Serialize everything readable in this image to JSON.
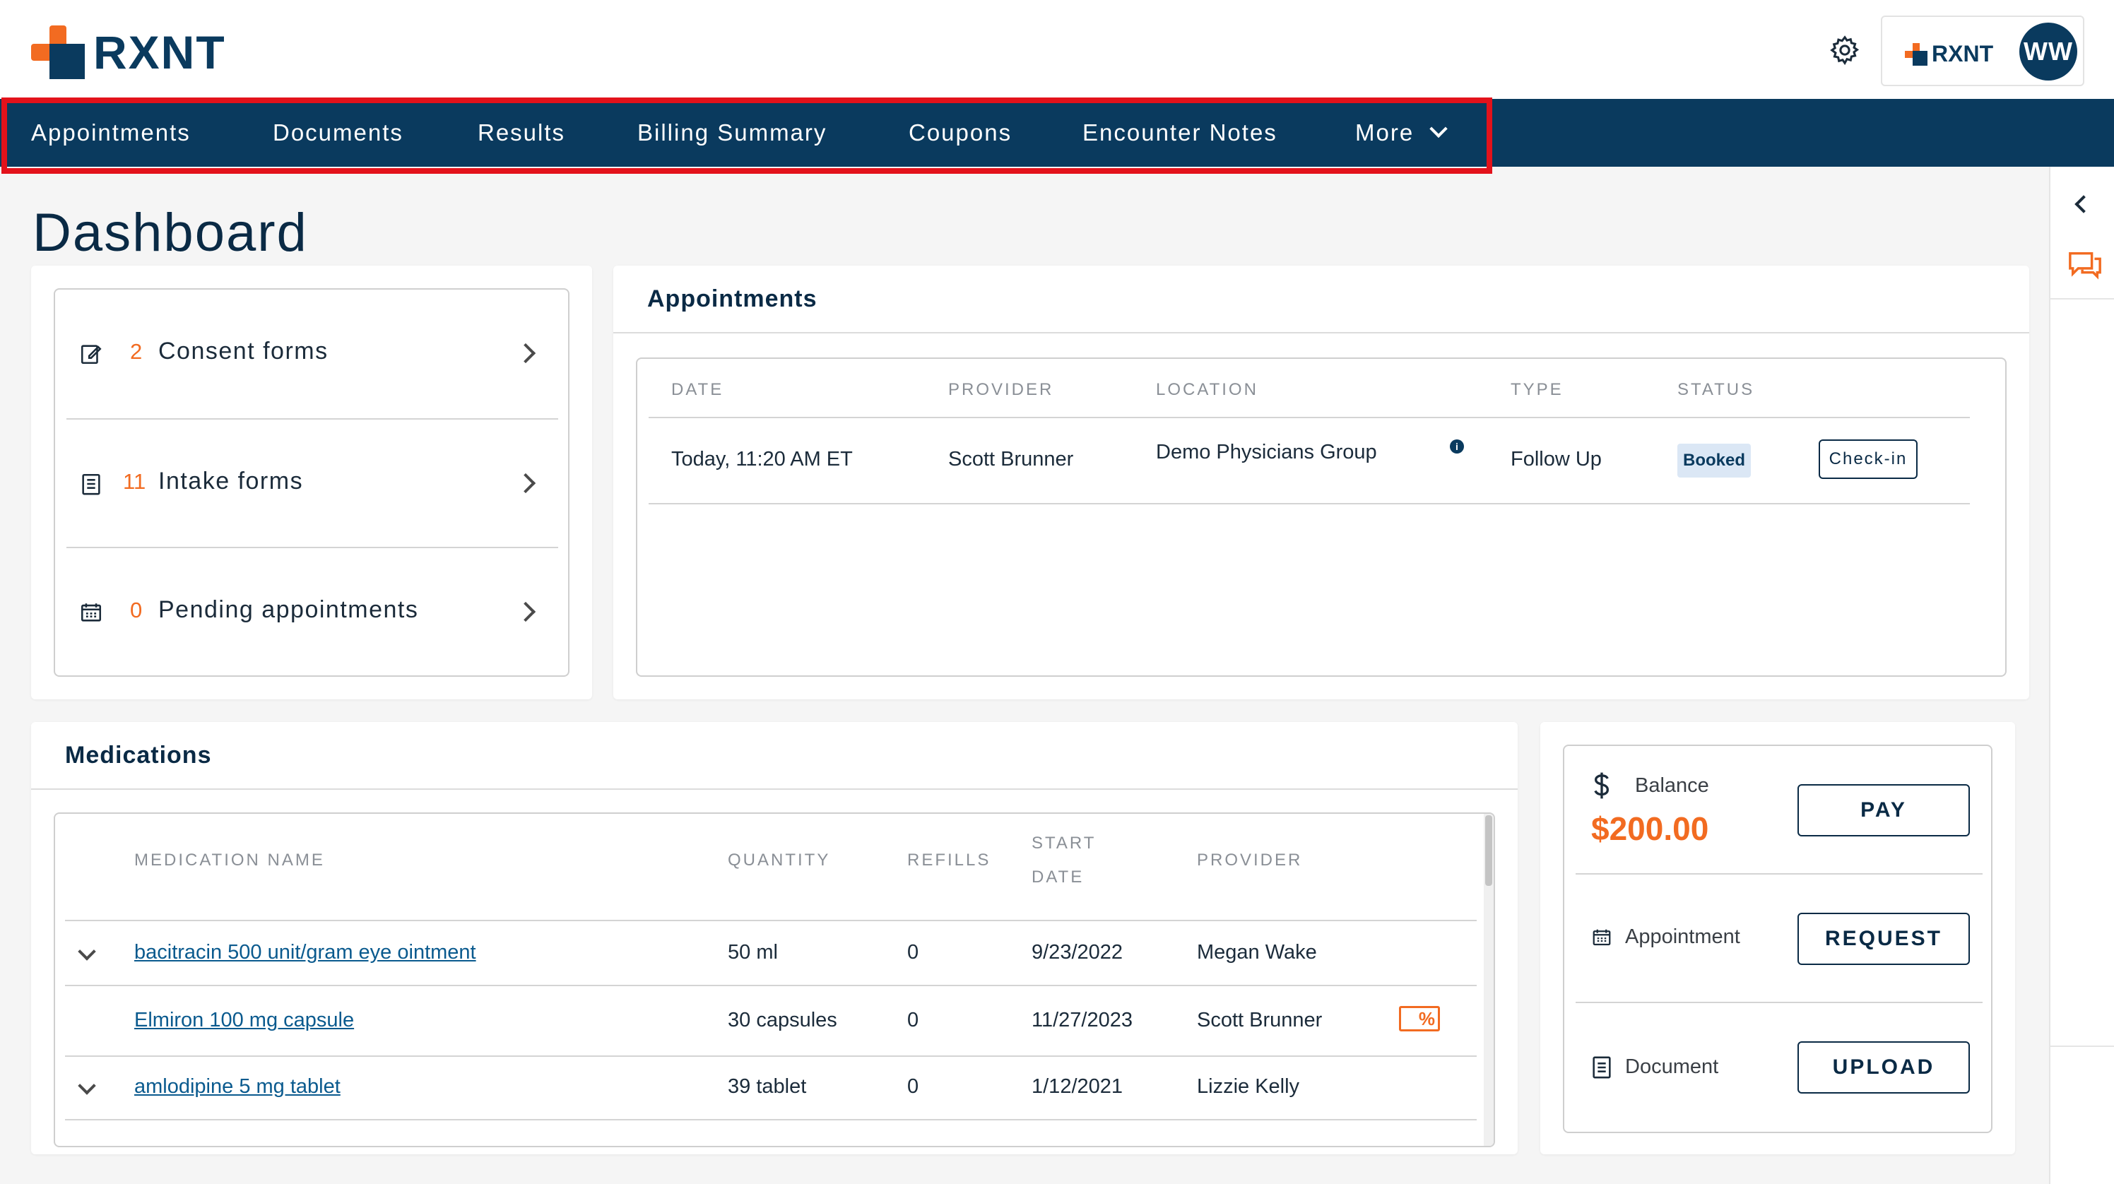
{
  "brand": {
    "name": "RXNT",
    "primary": "#0a3a5e",
    "accent": "#f26b21"
  },
  "header": {
    "settings_icon": "gear-icon",
    "chip_brand": "RXNT",
    "avatar_initials": "WW"
  },
  "nav": {
    "items": [
      {
        "label": "Appointments"
      },
      {
        "label": "Documents"
      },
      {
        "label": "Results"
      },
      {
        "label": "Billing Summary"
      },
      {
        "label": "Coupons"
      },
      {
        "label": "Encounter Notes"
      },
      {
        "label": "More"
      }
    ]
  },
  "page": {
    "title": "Dashboard"
  },
  "forms": [
    {
      "count": "2",
      "label": "Consent forms"
    },
    {
      "count": "11",
      "label": "Intake forms"
    },
    {
      "count": "0",
      "label": "Pending appointments"
    }
  ],
  "appointments": {
    "title": "Appointments",
    "columns": [
      "DATE",
      "PROVIDER",
      "LOCATION",
      "TYPE",
      "STATUS"
    ],
    "rows": [
      {
        "date": "Today, 11:20 AM ET",
        "provider": "Scott Brunner",
        "location": "Demo Physicians Group",
        "type": "Follow Up",
        "status": "Booked",
        "action": "Check-in"
      }
    ]
  },
  "medications": {
    "title": "Medications",
    "columns": {
      "name": "MEDICATION NAME",
      "quantity": "QUANTITY",
      "refills": "REFILLS",
      "start1": "START",
      "start2": "DATE",
      "provider": "PROVIDER"
    },
    "rows": [
      {
        "name": "bacitracin 500 unit/gram eye ointment",
        "quantity": "50 ml",
        "refills": "0",
        "start": "9/23/2022",
        "provider": "Megan Wake"
      },
      {
        "name": "Elmiron 100 mg capsule",
        "quantity": "30 capsules",
        "refills": "0",
        "start": "11/27/2023",
        "provider": "Scott Brunner"
      },
      {
        "name": "amlodipine 5 mg tablet",
        "quantity": "39 tablet",
        "refills": "0",
        "start": "1/12/2021",
        "provider": "Lizzie Kelly"
      }
    ]
  },
  "billing": {
    "balance_label": "Balance",
    "balance_amount": "$200.00",
    "pay_label": "PAY",
    "appointment_label": "Appointment",
    "request_label": "REQUEST",
    "document_label": "Document",
    "upload_label": "UPLOAD"
  }
}
